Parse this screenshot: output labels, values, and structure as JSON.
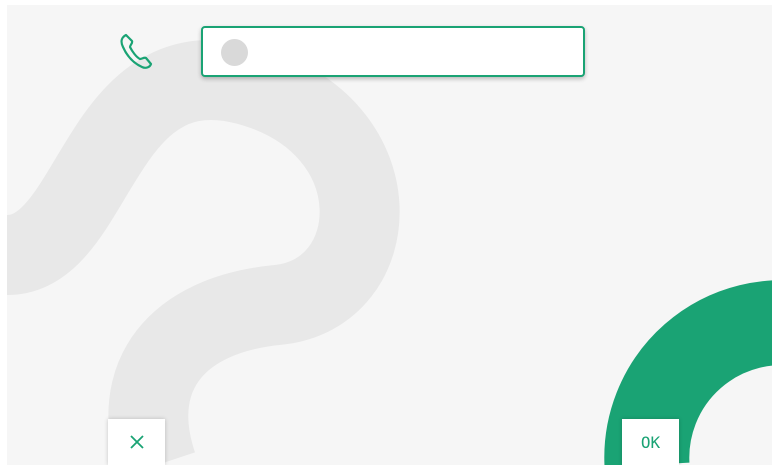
{
  "colors": {
    "accent": "#1aa374",
    "background": "#f6f6f6",
    "decoration": "#e8e8e8"
  },
  "header": {
    "icon": "phone-icon"
  },
  "input": {
    "value": "",
    "avatar_icon": "contact-dot-icon"
  },
  "softkeys": {
    "cancel": {
      "icon": "close-icon"
    },
    "ok": {
      "label": "OK"
    }
  }
}
